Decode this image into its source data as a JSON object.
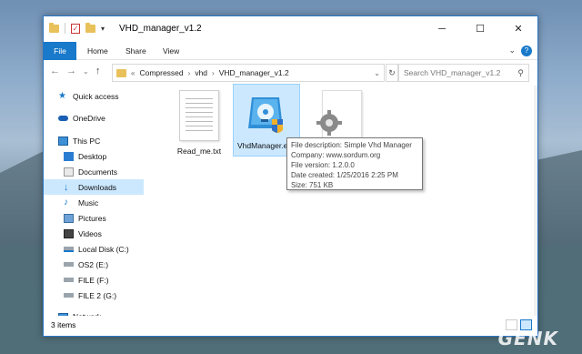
{
  "window": {
    "title": "VHD_manager_v1.2"
  },
  "ribbon": {
    "tabs": [
      "File",
      "Home",
      "Share",
      "View"
    ],
    "help": "?"
  },
  "address": {
    "prefix": "«",
    "crumbs": [
      "Compressed",
      "vhd",
      "VHD_manager_v1.2"
    ],
    "search_placeholder": "Search VHD_manager_v1.2"
  },
  "sidebar": {
    "items": [
      {
        "label": "Quick access",
        "icon": "star-icon"
      },
      {
        "label": "OneDrive",
        "icon": "cloud-icon"
      },
      {
        "label": "This PC",
        "icon": "computer-icon"
      },
      {
        "label": "Desktop",
        "icon": "desktop-icon"
      },
      {
        "label": "Documents",
        "icon": "documents-icon"
      },
      {
        "label": "Downloads",
        "icon": "download-icon"
      },
      {
        "label": "Music",
        "icon": "music-icon"
      },
      {
        "label": "Pictures",
        "icon": "pictures-icon"
      },
      {
        "label": "Videos",
        "icon": "videos-icon"
      },
      {
        "label": "Local Disk (C:)",
        "icon": "disk-icon"
      },
      {
        "label": "OS2 (E:)",
        "icon": "drive-icon"
      },
      {
        "label": "FILE (F:)",
        "icon": "drive-icon"
      },
      {
        "label": "FILE 2 (G:)",
        "icon": "drive-icon"
      },
      {
        "label": "Network",
        "icon": "network-icon"
      }
    ],
    "selected": "Downloads"
  },
  "files": [
    {
      "name": "Read_me.txt",
      "icon": "text-file-icon"
    },
    {
      "name": "VhdManager.ex",
      "icon": "vhd-manager-app-icon"
    },
    {
      "name": "",
      "icon": "settings-file-icon"
    }
  ],
  "tooltip": {
    "lines": [
      "File description: Simple Vhd Manager",
      "Company: www.sordum.org",
      "File version: 1.2.0.0",
      "Date created: 1/25/2016 2:25 PM",
      "Size: 751 KB"
    ]
  },
  "status": {
    "count": "3 items"
  },
  "watermark": "GENK",
  "colors": {
    "accent": "#1979ca",
    "selection": "#cce8ff"
  }
}
